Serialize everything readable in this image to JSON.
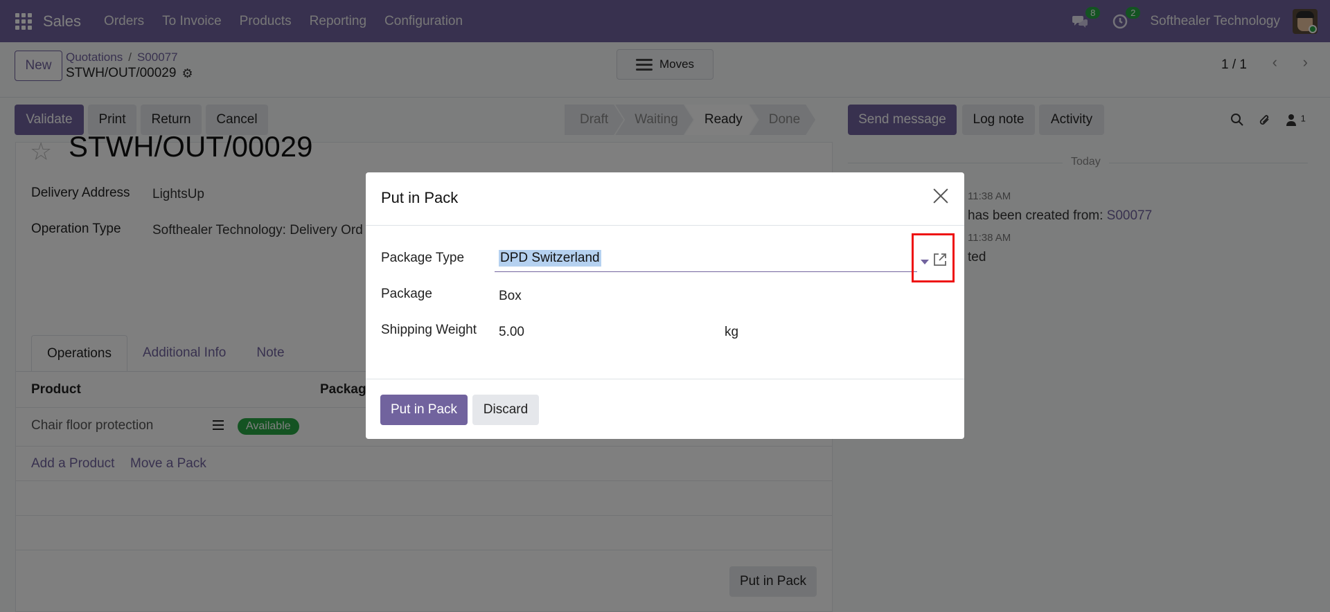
{
  "navbar": {
    "app_name": "Sales",
    "menu": [
      "Orders",
      "To Invoice",
      "Products",
      "Reporting",
      "Configuration"
    ],
    "messages_count": "8",
    "activities_count": "2",
    "company": "Softhealer Technology"
  },
  "control": {
    "new_label": "New",
    "breadcrumb": [
      "Quotations",
      "S00077"
    ],
    "record_title": "STWH/OUT/00029",
    "moves_label": "Moves",
    "pager": "1 / 1"
  },
  "actions": {
    "validate": "Validate",
    "print": "Print",
    "return": "Return",
    "cancel": "Cancel",
    "status": [
      "Draft",
      "Waiting",
      "Ready",
      "Done"
    ],
    "status_active": "Ready",
    "send_message": "Send message",
    "log_note": "Log note",
    "activity": "Activity",
    "followers_count": "1"
  },
  "form": {
    "name": "STWH/OUT/00029",
    "delivery_address_label": "Delivery Address",
    "delivery_address": "LightsUp",
    "operation_type_label": "Operation Type",
    "operation_type": "Softhealer Technology: Delivery Ord",
    "tabs": [
      "Operations",
      "Additional Info",
      "Note"
    ],
    "col_product": "Product",
    "col_package": "Package",
    "row_product": "Chair floor protection",
    "row_status": "Available",
    "add_product": "Add a Product",
    "move_pack": "Move a Pack",
    "put_in_pack": "Put in Pack"
  },
  "chatter": {
    "today": "Today",
    "msg1_time": "11:38 AM",
    "msg1_text": "has been created from:",
    "msg1_link": "S00077",
    "msg2_time": "11:38 AM",
    "msg2_text": "ted"
  },
  "modal": {
    "title": "Put in Pack",
    "package_type_label": "Package Type",
    "package_type_value": "DPD Switzerland",
    "package_label": "Package",
    "package_value": "Box",
    "weight_label": "Shipping Weight",
    "weight_value": "5.00",
    "weight_unit": "kg",
    "confirm_label": "Put in Pack",
    "discard_label": "Discard"
  },
  "colors": {
    "brand": "#71639e",
    "success": "#28a745",
    "highlight_box": "#ee1111"
  }
}
